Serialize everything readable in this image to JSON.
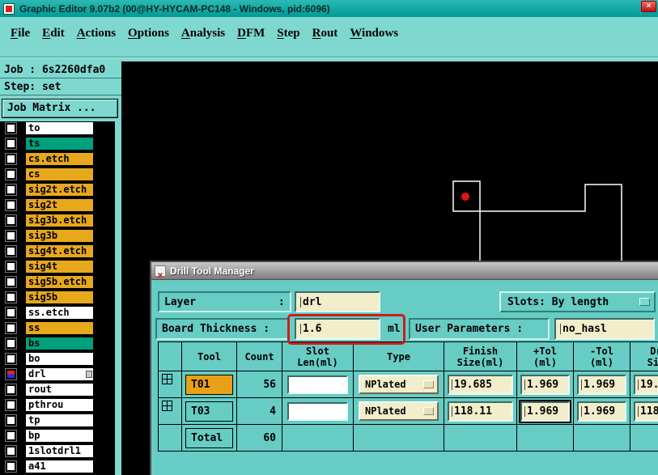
{
  "window": {
    "title": "Graphic Editor 9.07b2 (00@HY-HYCAM-PC148 - Windows, pid:6096)",
    "close_label": "×"
  },
  "menu": {
    "items": [
      {
        "label": "File"
      },
      {
        "label": "Edit"
      },
      {
        "label": "Actions"
      },
      {
        "label": "Options"
      },
      {
        "label": "Analysis"
      },
      {
        "label": "DFM"
      },
      {
        "label": "Step"
      },
      {
        "label": "Rout"
      },
      {
        "label": "Windows"
      }
    ]
  },
  "sidebar": {
    "job_label": "Job : 6s2260dfa0",
    "step_label": "Step: set",
    "job_matrix_label": "Job Matrix ...",
    "layers": [
      {
        "name": "to",
        "color": "white"
      },
      {
        "name": "ts",
        "color": "teal"
      },
      {
        "name": "cs.etch",
        "color": "yellow"
      },
      {
        "name": "cs",
        "color": "yellow"
      },
      {
        "name": "sig2t.etch",
        "color": "yellow"
      },
      {
        "name": "sig2t",
        "color": "yellow"
      },
      {
        "name": "sig3b.etch",
        "color": "yellow"
      },
      {
        "name": "sig3b",
        "color": "yellow"
      },
      {
        "name": "sig4t.etch",
        "color": "yellow"
      },
      {
        "name": "sig4t",
        "color": "yellow"
      },
      {
        "name": "sig5b.etch",
        "color": "yellow"
      },
      {
        "name": "sig5b",
        "color": "yellow"
      },
      {
        "name": "ss.etch",
        "color": "white"
      },
      {
        "name": "ss",
        "color": "yellow"
      },
      {
        "name": "bs",
        "color": "teal"
      },
      {
        "name": "bo",
        "color": "white"
      },
      {
        "name": "drl",
        "color": "white",
        "active": true
      },
      {
        "name": "rout",
        "color": "white"
      },
      {
        "name": "pthrou",
        "color": "white"
      },
      {
        "name": "tp",
        "color": "white"
      },
      {
        "name": "bp",
        "color": "white"
      },
      {
        "name": "1slotdrl1",
        "color": "white"
      },
      {
        "name": "a41",
        "color": "white"
      }
    ]
  },
  "dialog": {
    "title": "Drill Tool Manager",
    "layer_label": "Layer             :",
    "layer_value": "drl",
    "slots_label": "Slots: By length",
    "board_thickness_label": "Board Thickness :",
    "board_thickness_value": "1.6",
    "board_thickness_unit": "ml",
    "user_parameters_label": "User Parameters :",
    "user_parameters_value": "no_hasl",
    "table": {
      "headers": [
        "",
        "Tool",
        "Count",
        "Slot\nLen(ml)",
        "Type",
        "Finish\nSize(ml)",
        "+Tol\n(ml)",
        "-Tol\n(ml)",
        "Dr\nSiz"
      ],
      "rows": [
        {
          "tool": "T01",
          "count": "56",
          "slot_len": "",
          "type": "NPlated",
          "finish": "19.685",
          "plus_tol": "1.969",
          "minus_tol": "1.969",
          "drill": "19."
        },
        {
          "tool": "T03",
          "count": "4",
          "slot_len": "",
          "type": "NPlated",
          "finish": "118.11",
          "plus_tol": "1.969",
          "minus_tol": "1.969",
          "drill": "118"
        }
      ],
      "total_label": "Total",
      "total_count": "60"
    }
  },
  "colors": {
    "titlebar_teal": "#00a8a2",
    "menubar_teal": "#7fd8d0",
    "panel_teal": "#66ccc4",
    "layer_yellow": "#e8a81c",
    "layer_teal": "#00a07c",
    "field_cream": "#f2edca",
    "selected_orange": "#e8a018",
    "annotation_red": "#cc1d1d",
    "marker_red": "#e81010"
  }
}
